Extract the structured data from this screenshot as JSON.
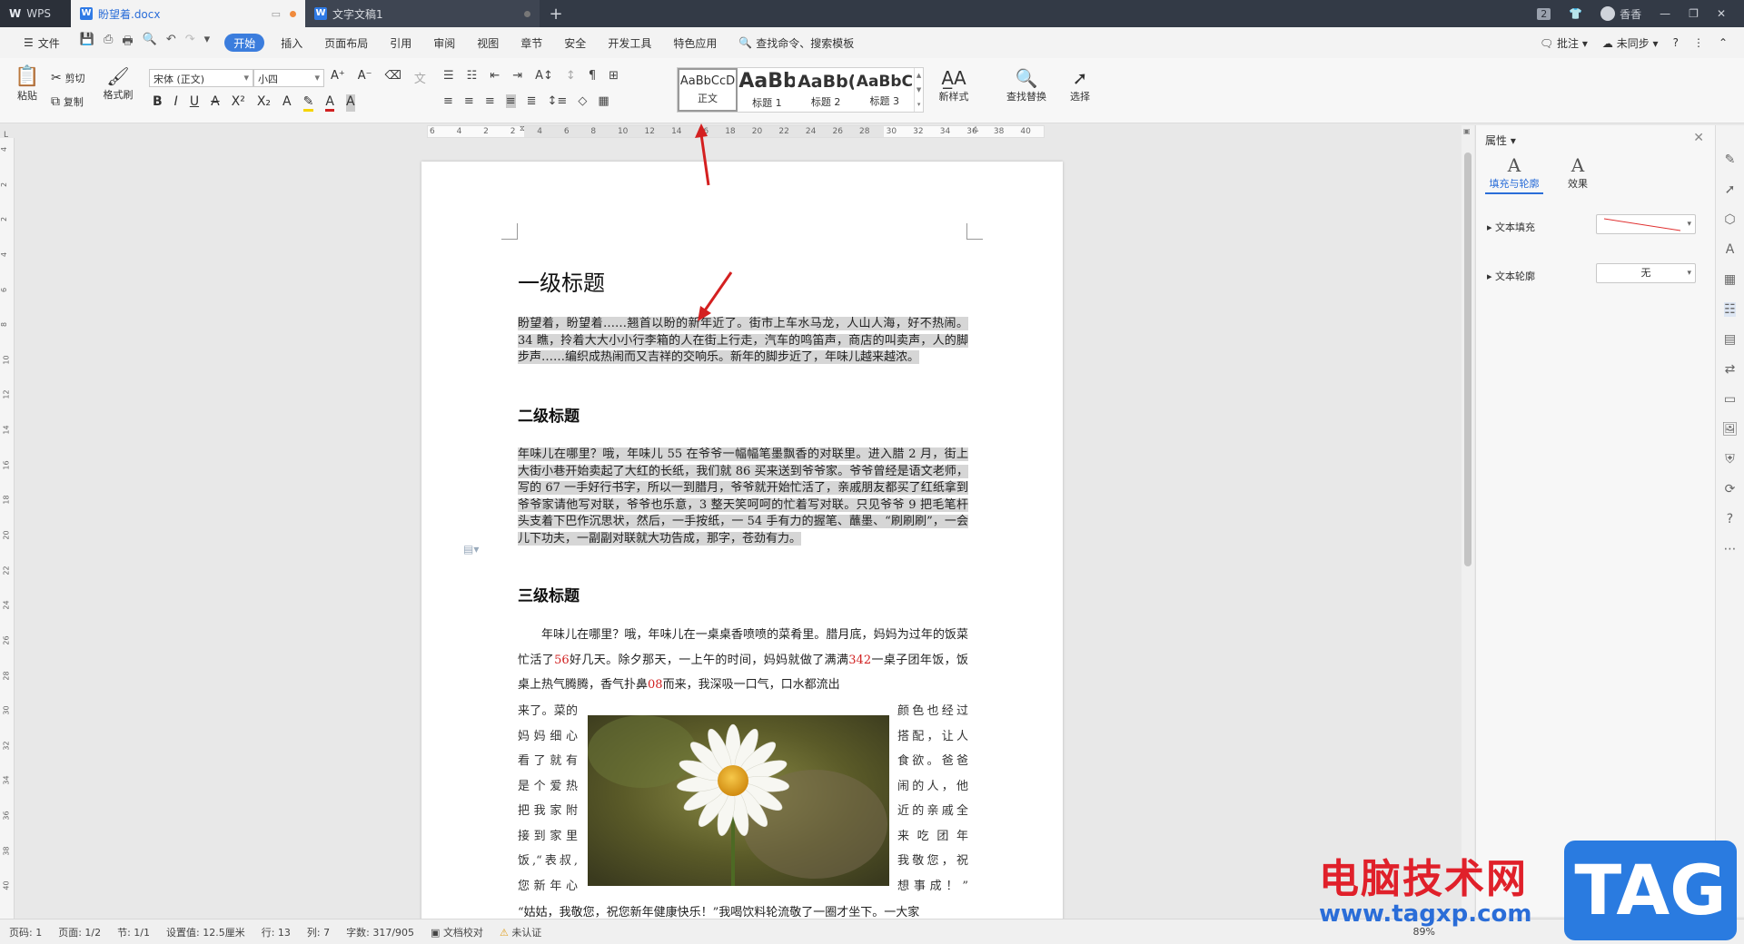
{
  "titlebar": {
    "app_label": "WPS",
    "tabs": [
      {
        "label": "盼望着.docx"
      },
      {
        "label": "文字文稿1"
      }
    ],
    "badge": "2",
    "user": "香香"
  },
  "menubar": {
    "file": "文件",
    "items": [
      "开始",
      "插入",
      "页面布局",
      "引用",
      "审阅",
      "视图",
      "章节",
      "安全",
      "开发工具",
      "特色应用"
    ],
    "active_index": 0,
    "search": "查找命令、搜索模板",
    "right": [
      "批注",
      "未同步"
    ]
  },
  "ribbon": {
    "paste": "粘贴",
    "cut": "剪切",
    "copy": "复制",
    "format_painter": "格式刷",
    "font_name": "宋体 (正文)",
    "font_size": "小四",
    "styles": [
      {
        "sample": "AaBbCcD",
        "name": "正文"
      },
      {
        "sample": "AaBb",
        "name": "标题 1"
      },
      {
        "sample": "AaBb(",
        "name": "标题 2"
      },
      {
        "sample": "AaBbC",
        "name": "标题 3"
      }
    ],
    "new_style": "新样式",
    "find_replace": "查找替换",
    "select": "选择"
  },
  "ruler": {
    "ticks": [
      "6",
      "4",
      "2",
      "2",
      "4",
      "6",
      "8",
      "10",
      "12",
      "14",
      "16",
      "18",
      "20",
      "22",
      "24",
      "26",
      "28",
      "30",
      "32",
      "34",
      "36",
      "38",
      "40"
    ]
  },
  "vruler": {
    "ticks": [
      "4",
      "2",
      "2",
      "4",
      "6",
      "8",
      "10",
      "12",
      "14",
      "16",
      "18",
      "20",
      "22",
      "24",
      "26",
      "28",
      "30",
      "32",
      "34",
      "36",
      "38",
      "40"
    ]
  },
  "document": {
    "h1": "一级标题",
    "p1": "盼望着，盼望着……翘首以盼的新年近了。街市上车水马龙，人山人海，好不热闹。34 瞧，拎着大大小小行李箱的人在街上行走，汽车的鸣笛声，商店的叫卖声，人的脚步声……编织成热闹而又吉祥的交响乐。新年的脚步近了，年味儿越来越浓。",
    "h2": "二级标题",
    "p2": "年味儿在哪里？哦，年味儿 55 在爷爷一幅幅笔墨飘香的对联里。进入腊 2 月，街上大街小巷开始卖起了大红的长纸，我们就 86 买来送到爷爷家。爷爷曾经是语文老师，写的 67 一手好行书字，所以一到腊月，爷爷就开始忙活了，亲戚朋友都买了红纸拿到爷爷家请他写对联，爷爷也乐意，3 整天笑呵呵的忙着写对联。只见爷爷 9 把毛笔杆头支着下巴作沉思状，然后，一手按纸，一 54 手有力的握笔、蘸墨、“刷刷刷”，一会儿下功夫，一副副对联就大功告成，那字，苍劲有力。",
    "h3": "三级标题",
    "p3_a": "年味儿在哪里？哦，年味儿在一桌桌香喷喷的菜肴里。腊月底，妈妈为过年的饭菜忙活了",
    "p3_n1": "56",
    "p3_b": "好几天。除夕那天，一上午的时间，妈妈就做了满满",
    "p3_n2": "342",
    "p3_c": "一桌子团年饭，饭桌上热气腾腾，香气扑鼻",
    "p3_n3": "08",
    "p3_d": "而来，我深吸一口气，口水都流出",
    "wrap_left": [
      "来了。菜的",
      "妈妈细心",
      "看了就有",
      "是个爱热",
      "把我家附",
      "接到家里",
      "饭,“表叔,",
      "您新年心"
    ],
    "wrap_right": [
      "颜色也经过",
      "搭配，让人",
      "食欲。爸爸",
      "闹的人，他",
      "近的亲戚全",
      "来吃团年",
      "我敬您，祝",
      "想事成！”"
    ],
    "last_line": "“姑姑，我敬您，祝您新年健康快乐！”我喝饮料轮流敬了一圈才坐下。一大家"
  },
  "props": {
    "title": "属性",
    "tabs": [
      "填充与轮廓",
      "效果"
    ],
    "fill_label": "文本填充",
    "outline_label": "文本轮廓",
    "outline_value": "无"
  },
  "status": {
    "items": [
      "页码: 1",
      "页面: 1/2",
      "节: 1/1",
      "设置值: 12.5厘米",
      "行: 13",
      "列: 7",
      "字数: 317/905",
      "文档校对",
      "未认证"
    ],
    "zoom": "89%"
  },
  "watermark": {
    "text": "电脑技术网",
    "url": "www.tagxp.com",
    "tag": "TAG"
  },
  "colors": {
    "accent": "#3b7ddd",
    "arrow": "#d42020",
    "selection": "#d6d6d6",
    "number_red": "#d12020"
  }
}
